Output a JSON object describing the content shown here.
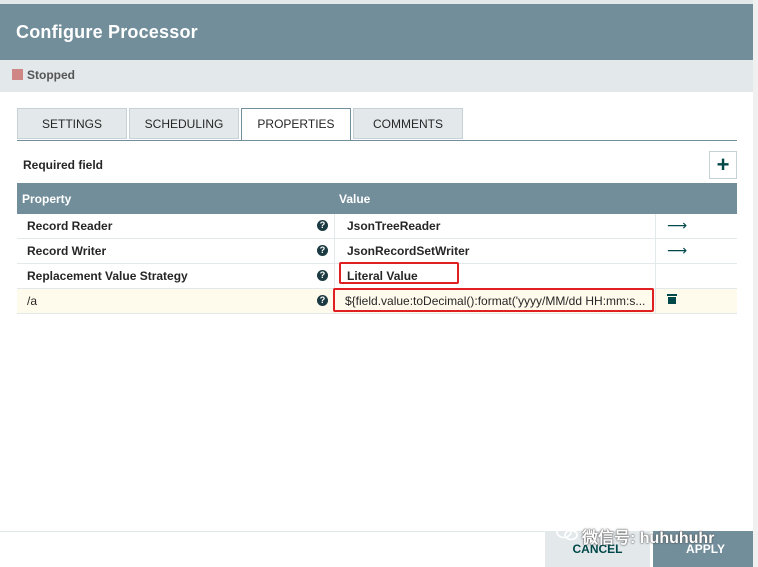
{
  "dialog": {
    "title": "Configure Processor",
    "status": "Stopped"
  },
  "tabs": [
    {
      "label": "SETTINGS"
    },
    {
      "label": "SCHEDULING"
    },
    {
      "label": "PROPERTIES"
    },
    {
      "label": "COMMENTS"
    }
  ],
  "active_tab": "PROPERTIES",
  "properties": {
    "required_label": "Required field",
    "add_label": "+",
    "columns": {
      "property": "Property",
      "value": "Value"
    },
    "rows": [
      {
        "name": "Record Reader",
        "value": "JsonTreeReader",
        "action_icon": "arrow-right-icon"
      },
      {
        "name": "Record Writer",
        "value": "JsonRecordSetWriter",
        "action_icon": "arrow-right-icon"
      },
      {
        "name": "Replacement Value Strategy",
        "value": "Literal Value"
      },
      {
        "name": "/a",
        "value": "${field.value:toDecimal():format('yyyy/MM/dd HH:mm:s...",
        "action_icon": "trash-icon"
      }
    ]
  },
  "footer": {
    "cancel": "CANCEL",
    "apply": "APPLY",
    "watermark": "微信号: huhuhuhr"
  },
  "colors": {
    "header": "#728e9b",
    "status_stopped": "#d18686",
    "accent": "#004849",
    "highlight_box": "#e02020"
  }
}
